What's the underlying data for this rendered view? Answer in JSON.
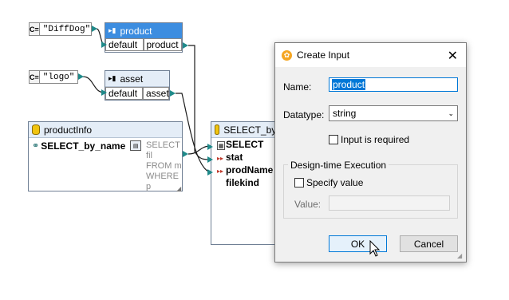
{
  "constants": [
    {
      "icon": "C=",
      "value": "\"DiffDog\""
    },
    {
      "icon": "C=",
      "value": "\"logo\""
    }
  ],
  "product_comp": {
    "title": "product",
    "in_label": "default",
    "out_label": "product"
  },
  "asset_comp": {
    "title": "asset",
    "in_label": "default",
    "out_label": "asset"
  },
  "productinfo": {
    "title": "productInfo",
    "field": "SELECT_by_name",
    "sql_lines": [
      "SELECT fil",
      "FROM   m",
      "WHERE p"
    ]
  },
  "select_comp": {
    "title": "SELECT_by_",
    "rows": [
      "SELECT stat",
      "prodName",
      "filekind"
    ]
  },
  "dialog": {
    "title": "Create Input",
    "name_label": "Name:",
    "name_value": "product",
    "datatype_label": "Datatype:",
    "datatype_value": "string",
    "required_label": "Input is required",
    "group_label": "Design-time Execution",
    "specify_label": "Specify value",
    "value_label": "Value:",
    "ok": "OK",
    "cancel": "Cancel"
  },
  "colors": {
    "selected_header": "#3c8de0",
    "wire": "#1b1b1b",
    "port": "#1f8a8a"
  }
}
